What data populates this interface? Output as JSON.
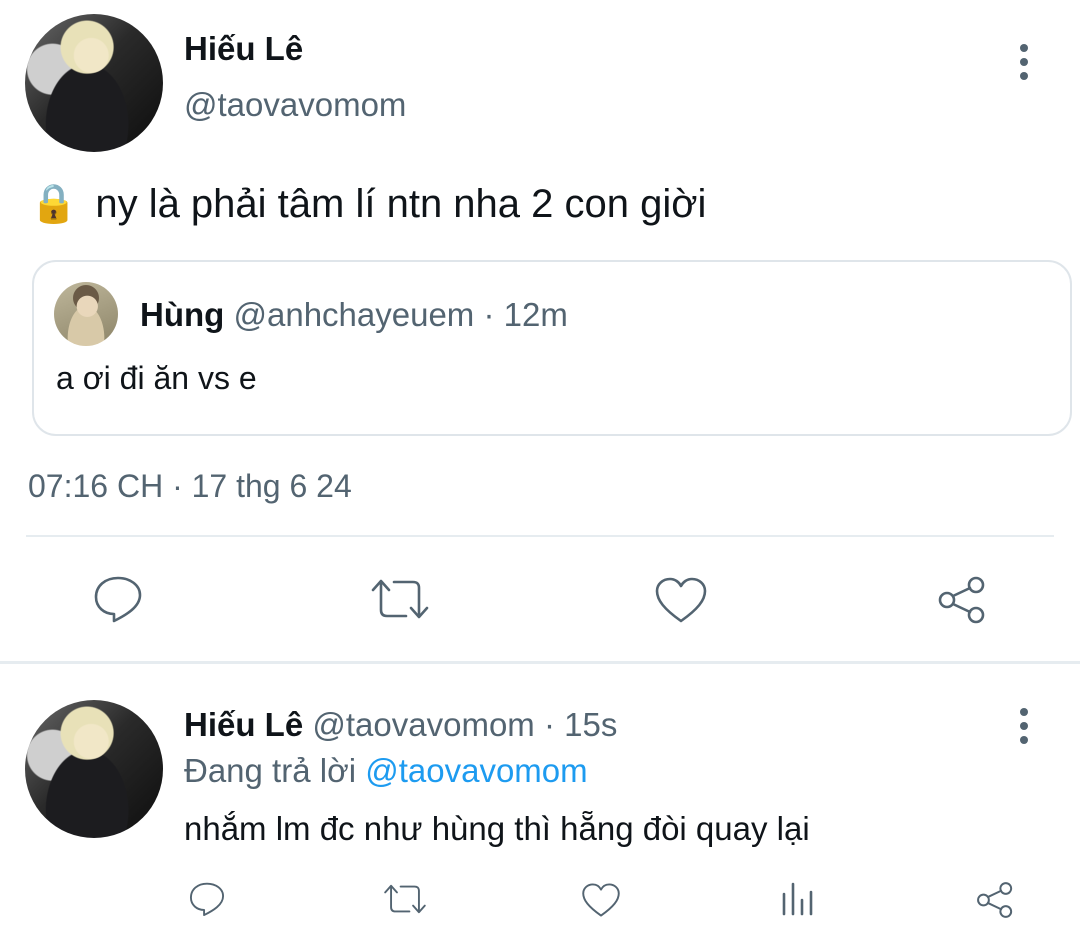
{
  "main_tweet": {
    "author_name": "Hiếu Lê",
    "author_handle": "@taovavomom",
    "lock_icon": "🔒",
    "text": "ny là phải tâm lí ntn nha 2 con giời",
    "quote": {
      "author_name": "Hùng",
      "author_handle": "@anhchayeuem",
      "separator": "·",
      "time": "12m",
      "text": "a ơi đi ăn vs e"
    },
    "timestamp": "07:16 CH · 17 thg 6 24",
    "actions": [
      "reply-icon",
      "retweet-icon",
      "like-icon",
      "share-icon"
    ]
  },
  "reply_tweet": {
    "author_name": "Hiếu Lê",
    "author_handle": "@taovavomom",
    "separator": "·",
    "time": "15s",
    "replying_prefix": "Đang trả lời",
    "replying_to": "@taovavomom",
    "text": "nhắm lm đc như hùng thì hẵng đòi quay lại",
    "actions": [
      "reply-icon",
      "retweet-icon",
      "like-icon",
      "views-icon",
      "share-icon"
    ]
  },
  "colors": {
    "text": "#0f1419",
    "muted": "#536471",
    "accent": "#1d9bf0",
    "border": "#dfe5ea"
  }
}
